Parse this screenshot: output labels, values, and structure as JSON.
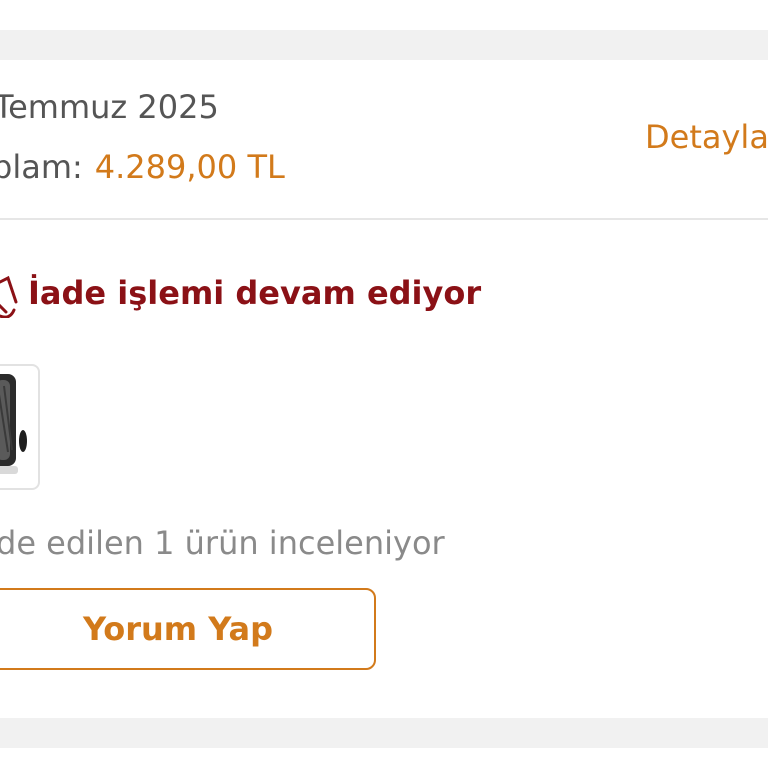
{
  "order": {
    "date_text": "Temmuz 2025",
    "total_label": "plam:",
    "total_value": "4.289,00 TL",
    "details_link": "Detayla"
  },
  "status": {
    "icon": "return-arrow-icon",
    "text": "İade işlemi devam ediyor",
    "color": "#8b1116"
  },
  "product": {
    "thumbnail": "product-thumbnail"
  },
  "return_info": "de edilen 1 ürün inceleniyor",
  "actions": {
    "review_label": "Yorum Yap"
  },
  "colors": {
    "accent": "#d27a1b",
    "status_red": "#8b1116",
    "muted_text": "#8a8a8a"
  }
}
